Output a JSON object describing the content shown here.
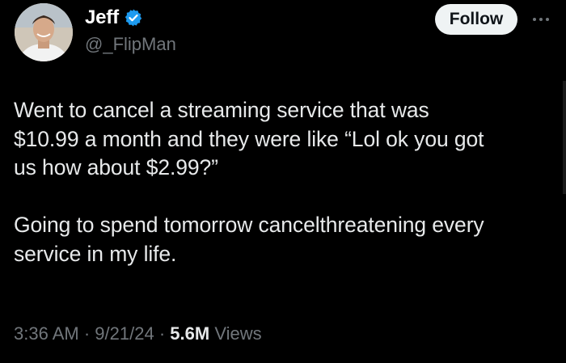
{
  "author": {
    "display_name": "Jeff",
    "handle": "@_FlipMan",
    "verified": true
  },
  "actions": {
    "follow_label": "Follow",
    "more_icon": "more-horizontal-icon"
  },
  "tweet": {
    "paragraphs": [
      [
        "Went to cancel a streaming service that was",
        "$10.99 a month and they were like “Lol ok you got",
        "us how about $2.99?”"
      ],
      [
        "Going to spend tomorrow cancelthreatening every",
        "service in my life."
      ]
    ]
  },
  "meta": {
    "time": "3:36 AM",
    "separator": "·",
    "date": "9/21/24",
    "views_count": "5.6M",
    "views_label": "Views"
  },
  "colors": {
    "background": "#000000",
    "text_primary": "#e7e9ea",
    "text_secondary": "#71767b",
    "verified_badge": "#1d9bf0",
    "follow_bg": "#eff3f4"
  }
}
